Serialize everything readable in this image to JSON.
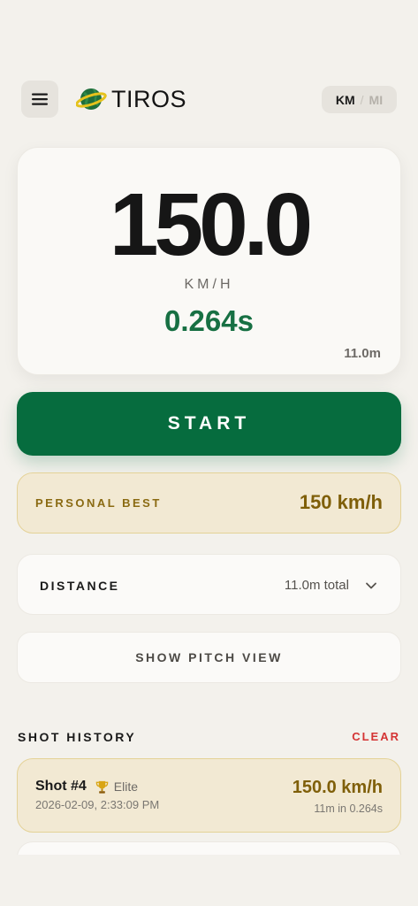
{
  "header": {
    "brand": "TIROS",
    "menu_icon": "hamburger-icon",
    "logo_icon": "planet-ball-icon",
    "unit_toggle": {
      "km": "KM",
      "separator": "/",
      "mi": "MI",
      "selected": "KM"
    }
  },
  "speed_card": {
    "speed": "150.0",
    "unit": "KM/H",
    "time": "0.264s",
    "distance": "11.0m"
  },
  "start_button": {
    "label": "START"
  },
  "personal_best": {
    "label": "PERSONAL BEST",
    "value": "150 km/h"
  },
  "distance_row": {
    "label": "DISTANCE",
    "total": "11.0m total",
    "icon": "chevron-down-icon"
  },
  "pitch_view": {
    "label": "SHOW PITCH VIEW"
  },
  "history": {
    "title": "SHOT HISTORY",
    "clear_label": "CLEAR",
    "shots": [
      {
        "number": "Shot #4",
        "tier": "Elite",
        "tier_icon": "trophy-icon",
        "date": "2026-02-09, 2:33:09 PM",
        "speed": "150.0 km/h",
        "detail": "11m in 0.264s"
      }
    ]
  },
  "colors": {
    "background": "#f3f1ec",
    "accent_green": "#066c3e",
    "time_green": "#177043",
    "gold_text": "#7f5f09",
    "gold_bg": "#f2e9d3",
    "clear_red": "#d43434"
  }
}
